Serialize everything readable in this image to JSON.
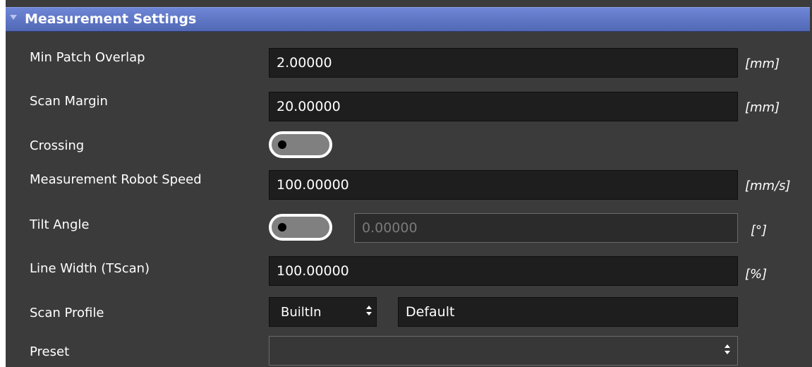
{
  "section": {
    "title": "Measurement Settings",
    "collapse_icon": "triangle-down-icon"
  },
  "rows": {
    "min_patch_overlap": {
      "label": "Min Patch Overlap",
      "value": "2.00000",
      "unit": "[mm]"
    },
    "scan_margin": {
      "label": "Scan Margin",
      "value": "20.00000",
      "unit": "[mm]"
    },
    "crossing": {
      "label": "Crossing",
      "enabled": false
    },
    "robot_speed": {
      "label": "Measurement Robot Speed",
      "value": "100.00000",
      "unit": "[mm/s]"
    },
    "tilt_angle": {
      "label": "Tilt Angle",
      "enabled": false,
      "value": "0.00000",
      "unit": "[°]"
    },
    "line_width": {
      "label": "Line Width (TScan)",
      "value": "100.00000",
      "unit": "[%]"
    },
    "scan_profile": {
      "label": "Scan Profile",
      "source": "BuiltIn",
      "name": "Default"
    },
    "preset": {
      "label": "Preset",
      "value": ""
    }
  },
  "colors": {
    "header_top": "#6e86d6",
    "header_bottom": "#5168b5",
    "panel_bg": "#3b3b3b",
    "field_bg": "#1e1e1e",
    "toggle_bg": "#808080"
  }
}
